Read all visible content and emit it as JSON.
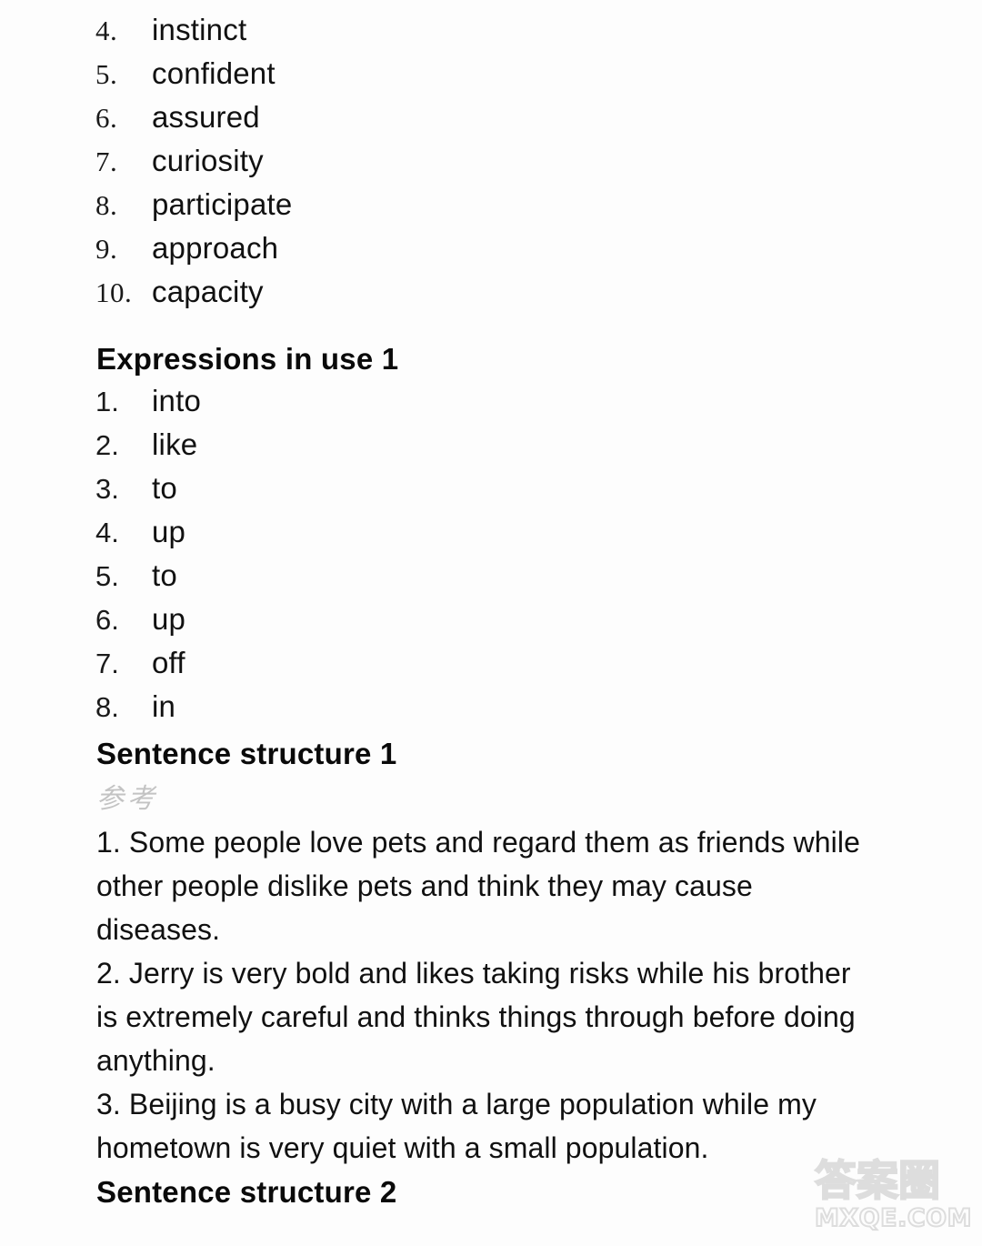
{
  "page": {
    "background_color": "#fdfdfd",
    "text_color": "#111111"
  },
  "vocabulary_list": {
    "items": [
      {
        "number": "4.",
        "word": "instinct"
      },
      {
        "number": "5.",
        "word": "confident"
      },
      {
        "number": "6.",
        "word": "assured"
      },
      {
        "number": "7.",
        "word": "curiosity"
      },
      {
        "number": "8.",
        "word": "participate"
      },
      {
        "number": "9.",
        "word": "approach"
      },
      {
        "number": "10.",
        "word": "capacity"
      }
    ]
  },
  "expressions_section": {
    "heading": "Expressions in use 1",
    "items": [
      {
        "number": "1.",
        "word": "into"
      },
      {
        "number": "2.",
        "word": "like"
      },
      {
        "number": "3.",
        "word": "to"
      },
      {
        "number": "4.",
        "word": "up"
      },
      {
        "number": "5.",
        "word": "to"
      },
      {
        "number": "6.",
        "word": "up"
      },
      {
        "number": "7.",
        "word": "off"
      },
      {
        "number": "8.",
        "word": "in"
      }
    ]
  },
  "sentence_structure_1": {
    "heading": "Sentence structure 1",
    "note": "参考",
    "note_color": "#b9b9b9",
    "answers": [
      "1. Some people love pets and regard them as friends while other people dislike pets and think they may cause diseases.",
      "2. Jerry is very bold and likes taking risks while his brother is extremely careful and thinks things through before doing anything.",
      "3. Beijing is a busy city with a large population while my hometown is very quiet with a small population."
    ]
  },
  "sentence_structure_2": {
    "heading": "Sentence structure 2"
  },
  "watermark": {
    "logo_text": "答案圈",
    "url_text": "MXQE.COM",
    "color": "#dddddd"
  }
}
